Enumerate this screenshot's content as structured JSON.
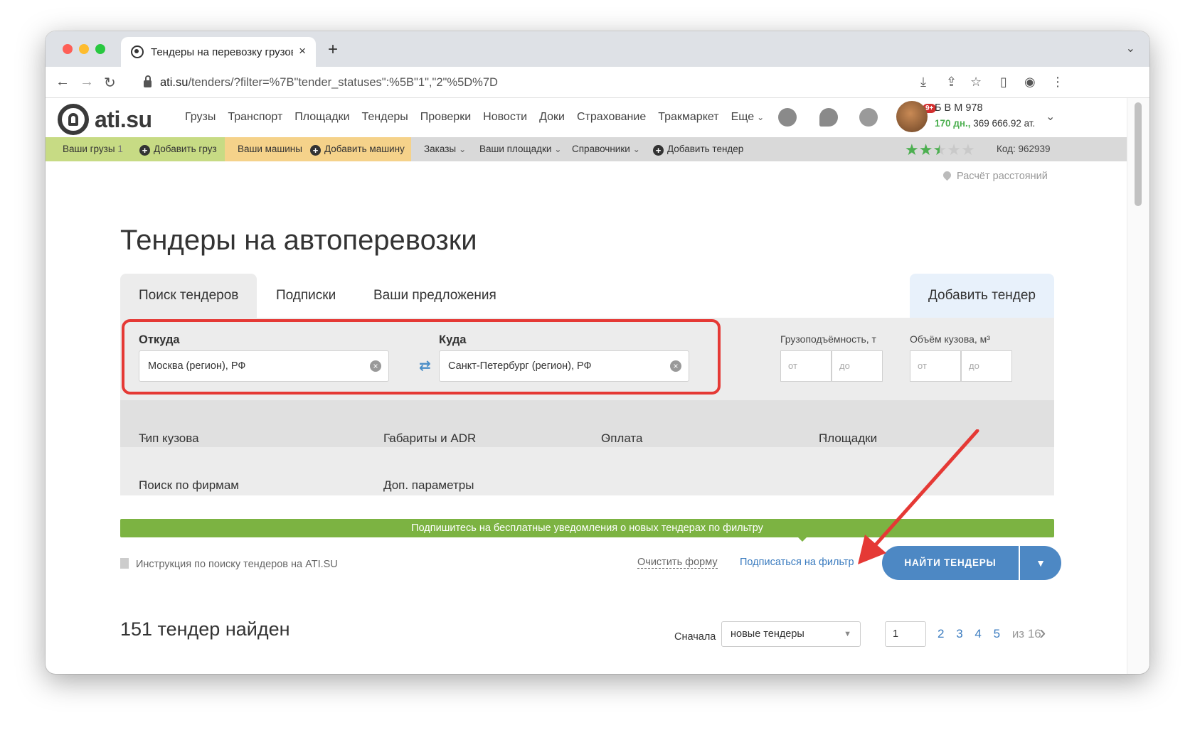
{
  "browser": {
    "tab_title": "Тендеры на перевозку грузов",
    "url_domain": "ati.su",
    "url_path": "/tenders/?filter=%7B\"tender_statuses\":%5B\"1\",\"2\"%5D%7D"
  },
  "site": {
    "logo_text": "ati.su",
    "nav": [
      "Грузы",
      "Транспорт",
      "Площадки",
      "Тендеры",
      "Проверки",
      "Новости",
      "Доки",
      "Страхование",
      "Тракмаркет",
      "Еще"
    ],
    "notification_badge": "9+",
    "user": {
      "name": "Б В М 978",
      "days": "170 дн.,",
      "balance": "369 666.92 ат."
    }
  },
  "subbar": {
    "your_cargo": "Ваши грузы",
    "your_cargo_count": "1",
    "add_cargo": "Добавить груз",
    "your_trucks": "Ваши машины",
    "add_truck": "Добавить машину",
    "orders": "Заказы",
    "your_platforms": "Ваши площадки",
    "directories": "Справочники",
    "add_tender": "Добавить тендер",
    "rating": 2.5,
    "code": "Код: 962939"
  },
  "page": {
    "distance_calc": "Расчёт расстояний",
    "title": "Тендеры на автоперевозки",
    "tabs": [
      "Поиск тендеров",
      "Подписки",
      "Ваши предложения"
    ],
    "add_tender_tab": "Добавить тендер"
  },
  "filter": {
    "from_label": "Откуда",
    "from_value": "Москва (регион), РФ",
    "to_label": "Куда",
    "to_value": "Санкт-Петербург (регион), РФ",
    "capacity_label": "Грузоподъёмность, т",
    "volume_label": "Объём кузова, м³",
    "range_from": "от",
    "range_to": "до",
    "body_type": "Тип кузова",
    "dimensions": "Габариты и ADR",
    "payment": "Оплата",
    "platforms": "Площадки",
    "firm_search": "Поиск по фирмам",
    "extra_params": "Доп. параметры"
  },
  "subscribe_banner": "Подпишитесь на бесплатные уведомления о новых тендерах по фильтру",
  "actions": {
    "instruction": "Инструкция по поиску тендеров на ATI.SU",
    "clear_form": "Очистить форму",
    "subscribe": "Подписаться на фильтр",
    "find": "НАЙТИ ТЕНДЕРЫ"
  },
  "results": {
    "count_text": "151 тендер найден",
    "sort_label": "Сначала",
    "sort_value": "новые тендеры",
    "current_page": "1",
    "pages": [
      "2",
      "3",
      "4",
      "5"
    ],
    "total_pages": "из 16"
  },
  "colors": {
    "accent_blue": "#4d88c4",
    "banner_green": "#7cb342",
    "highlight_red": "#e53935"
  }
}
